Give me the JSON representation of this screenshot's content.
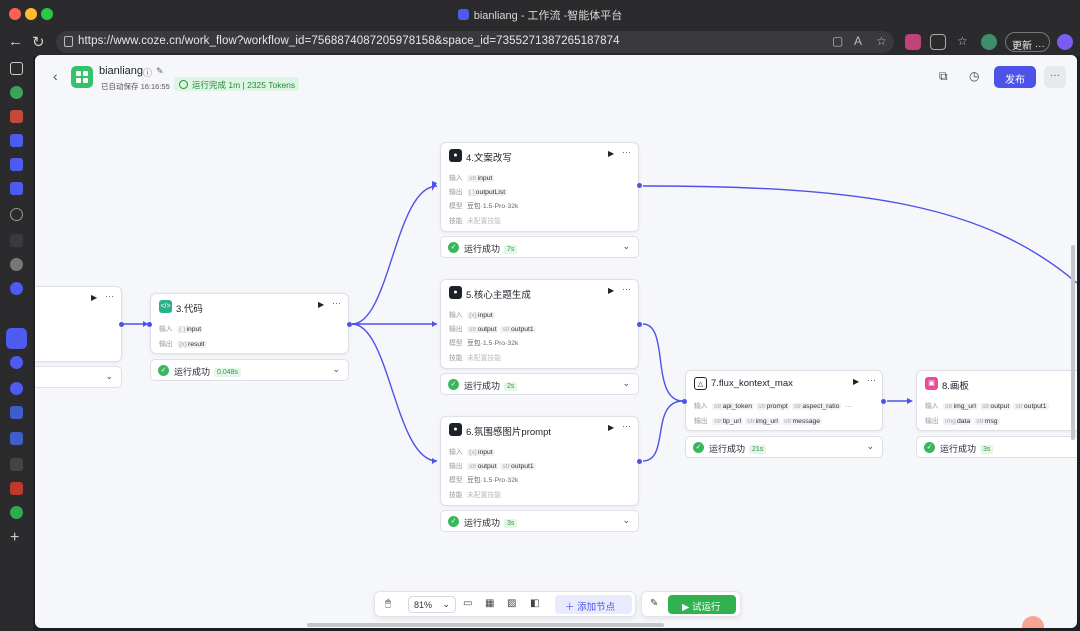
{
  "browser": {
    "window_title": "bianliang - 工作流 -智能体平台",
    "url": "https://www.coze.cn/work_flow?workflow_id=7568874087205978158&space_id=7355271387265187874",
    "update_label": "更新"
  },
  "header": {
    "workflow_name": "bianliang",
    "autosave": "已自动保存 16:16:55",
    "run_status": "运行完成 1m | 2325 Tokens",
    "publish_label": "发布",
    "more_label": "···"
  },
  "nodes": {
    "n3": {
      "title": "3.代码",
      "input_label": "输入",
      "output_label": "输出",
      "input_type": "{ }",
      "input": "input",
      "output_type": "{x}",
      "output": "result",
      "status": "运行成功",
      "time": "0.048s"
    },
    "n4": {
      "title": "4.文案改写",
      "input_label": "输入",
      "output_label": "输出",
      "model_label": "模型",
      "skill_label": "技能",
      "input_type": "str",
      "input": "input",
      "output_type": "[ ]",
      "output": "outputList",
      "model": "豆包·1.5·Pro·32k",
      "skill": "未配置技能",
      "status": "运行成功",
      "time": "7s"
    },
    "n5": {
      "title": "5.核心主题生成",
      "input_label": "输入",
      "output_label": "输出",
      "model_label": "模型",
      "skill_label": "技能",
      "input_type": "{x}",
      "input": "input",
      "output_type": "str",
      "output": "output",
      "output2_type": "str",
      "output2": "output1",
      "model": "豆包·1.5·Pro·32k",
      "skill": "未配置技能",
      "status": "运行成功",
      "time": "2s"
    },
    "n6": {
      "title": "6.氛围感图片prompt",
      "input_label": "输入",
      "output_label": "输出",
      "model_label": "模型",
      "skill_label": "技能",
      "input_type": "{x}",
      "input": "input",
      "output_type": "str",
      "output": "output",
      "output2_type": "str",
      "output2": "output1",
      "model": "豆包·1.5·Pro·32k",
      "skill": "未配置技能",
      "status": "运行成功",
      "time": "3s"
    },
    "n7": {
      "title": "7.flux_kontext_max",
      "input_label": "输入",
      "output_label": "输出",
      "in_type": "str",
      "in1": "api_token",
      "in2": "prompt",
      "in3": "aspect_ratio",
      "more": "···",
      "out_type": "str",
      "out1": "tip_url",
      "out2": "img_url",
      "out3": "message",
      "status": "运行成功",
      "time": "21s"
    },
    "n8": {
      "title": "8.画板",
      "input_label": "输入",
      "output_label": "输出",
      "in_type": "str",
      "in1": "img_url",
      "in2": "output",
      "in3": "output1",
      "out1_type": "img",
      "out1": "data",
      "out2_type": "str",
      "out2": "msg",
      "status": "运行成功",
      "time": "3s"
    }
  },
  "toolbar": {
    "zoom": "81%",
    "add_node": "添加节点",
    "test_run": "试运行"
  }
}
